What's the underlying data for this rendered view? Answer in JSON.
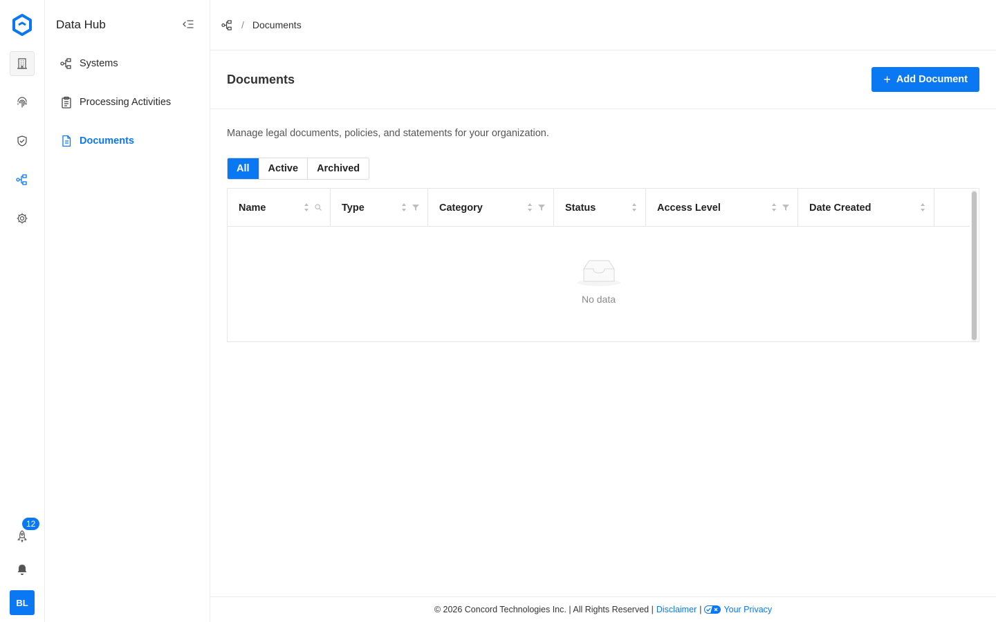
{
  "sidebar": {
    "title": "Data Hub",
    "items": [
      {
        "label": "Systems"
      },
      {
        "label": "Processing Activities"
      },
      {
        "label": "Documents"
      }
    ]
  },
  "rail": {
    "badge_count": "12",
    "avatar_initials": "BL"
  },
  "breadcrumb": {
    "current": "Documents",
    "separator": "/"
  },
  "page": {
    "title": "Documents",
    "add_button_label": "Add Document",
    "description": "Manage legal documents, policies, and statements for your organization."
  },
  "filters": {
    "tabs": [
      {
        "label": "All",
        "selected": true
      },
      {
        "label": "Active",
        "selected": false
      },
      {
        "label": "Archived",
        "selected": false
      }
    ]
  },
  "table": {
    "columns": [
      {
        "label": "Name"
      },
      {
        "label": "Type"
      },
      {
        "label": "Category"
      },
      {
        "label": "Status"
      },
      {
        "label": "Access Level"
      },
      {
        "label": "Date Created"
      }
    ],
    "empty_text": "No data"
  },
  "footer": {
    "copyright": "© 2026 Concord Technologies Inc. | All Rights Reserved |",
    "disclaimer": "Disclaimer",
    "pipe": "|",
    "privacy": "Your Privacy"
  },
  "colors": {
    "accent": "#0a78f2",
    "border": "#ececec"
  }
}
